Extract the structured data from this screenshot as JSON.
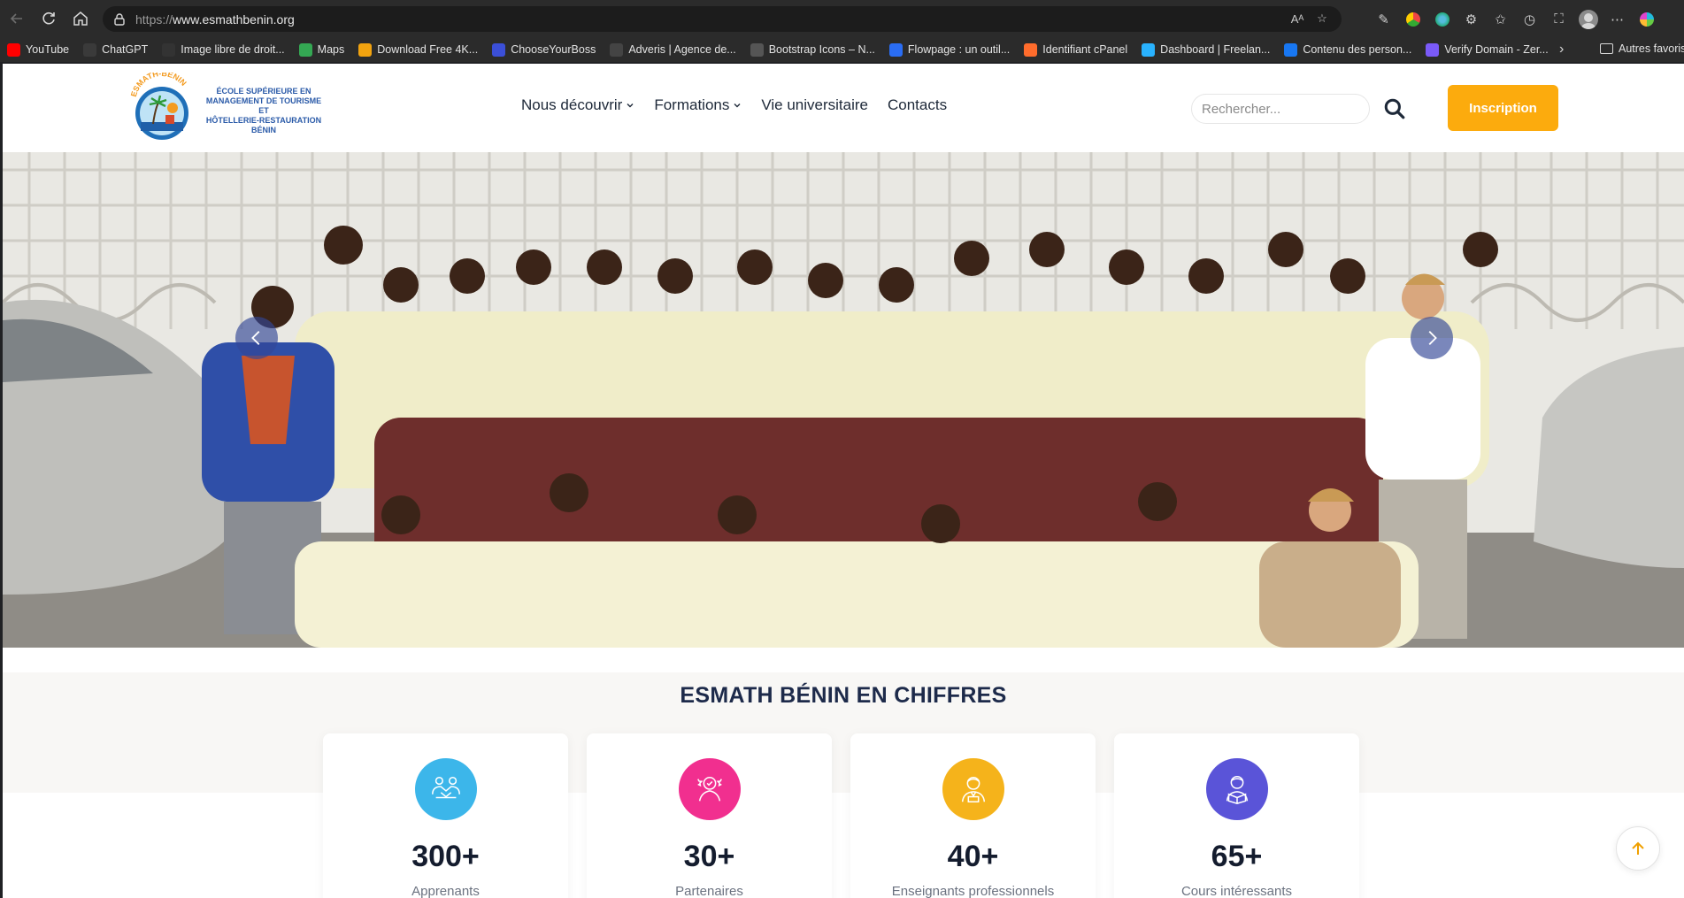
{
  "browser": {
    "url_prefix": "https://",
    "url_host": "www.esmathbenin.org",
    "bookmarks": [
      {
        "label": "YouTube",
        "icon": "youtube-icon",
        "color": "#ff0000"
      },
      {
        "label": "ChatGPT",
        "icon": "chatgpt-icon",
        "color": "#3a3a3a"
      },
      {
        "label": "Image libre de droit...",
        "icon": "pexels-icon",
        "color": "#333333"
      },
      {
        "label": "Maps",
        "icon": "maps-icon",
        "color": "#34a853"
      },
      {
        "label": "Download Free 4K...",
        "icon": "download-icon",
        "color": "#f2a30f"
      },
      {
        "label": "ChooseYourBoss",
        "icon": "chooseyourboss-icon",
        "color": "#3b4fd8"
      },
      {
        "label": "Adveris | Agence de...",
        "icon": "adveris-icon",
        "color": "#444444"
      },
      {
        "label": "Bootstrap Icons – N...",
        "icon": "bootstrap-icon",
        "color": "#555555"
      },
      {
        "label": "Flowpage : un outil...",
        "icon": "flowpage-icon",
        "color": "#2a6df4"
      },
      {
        "label": "Identifiant cPanel",
        "icon": "cpanel-icon",
        "color": "#ff6c2c"
      },
      {
        "label": "Dashboard | Freelan...",
        "icon": "freelancer-icon",
        "color": "#29b2fe"
      },
      {
        "label": "Contenu des person...",
        "icon": "facebook-icon",
        "color": "#1877f2"
      },
      {
        "label": "Verify Domain - Zer...",
        "icon": "puzzle-icon",
        "color": "#7a5af8"
      }
    ],
    "other_favorites": "Autres favoris"
  },
  "header": {
    "logo_arc_text": "ESMATH-BENIN",
    "logo_lines": [
      "ÉCOLE SUPÉRIEURE EN",
      "MANAGEMENT DE TOURISME ET",
      "HÔTELLERIE-RESTAURATION",
      "BÉNIN"
    ],
    "menu": [
      {
        "label": "Nous découvrir",
        "dropdown": true
      },
      {
        "label": "Formations",
        "dropdown": true
      },
      {
        "label": "Vie universitaire",
        "dropdown": false
      },
      {
        "label": "Contacts",
        "dropdown": false
      }
    ],
    "search_placeholder": "Rechercher...",
    "cta_label": "Inscription",
    "accent": "#fcab0d"
  },
  "hero": {
    "image": "group-photo-students-in-uniform"
  },
  "stats": {
    "title": "ESMATH BÉNIN EN CHIFFRES",
    "items": [
      {
        "value": "300+",
        "label": "Apprenants",
        "color": "#3cb6ea",
        "icon": "handshake-icon"
      },
      {
        "value": "30+",
        "label": "Partenaires",
        "color": "#f12f8f",
        "icon": "partner-award-icon"
      },
      {
        "value": "40+",
        "label": "Enseignants professionnels",
        "color": "#f5b31b",
        "icon": "teacher-icon"
      },
      {
        "value": "65+",
        "label": "Cours intéressants",
        "color": "#5a54d8",
        "icon": "student-reading-icon"
      }
    ]
  }
}
